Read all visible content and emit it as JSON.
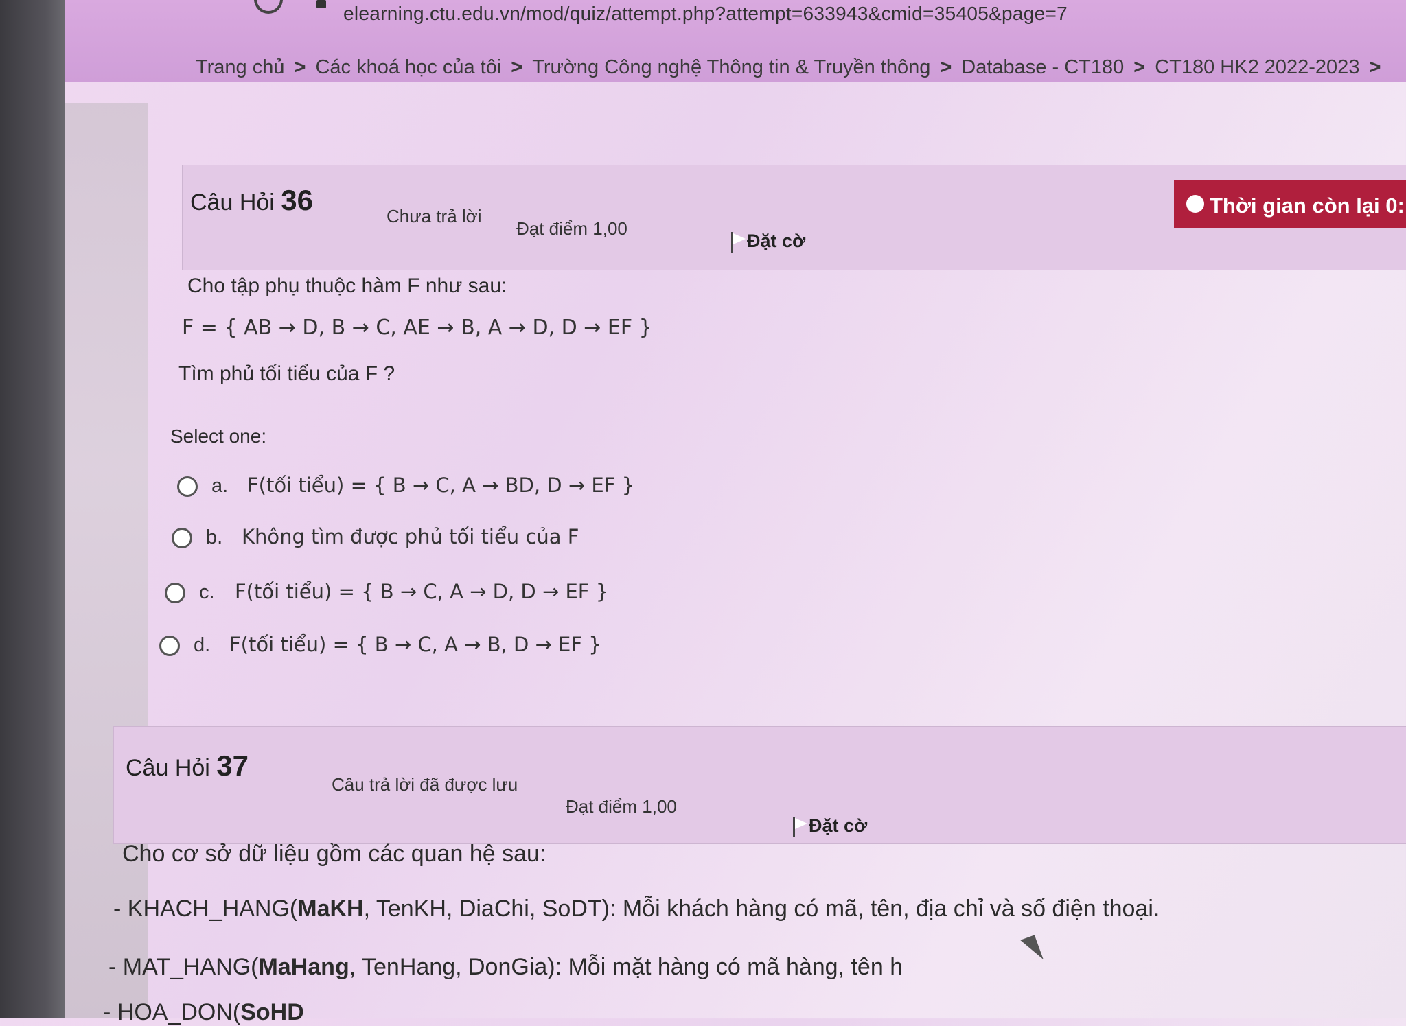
{
  "browser": {
    "url": "elearning.ctu.edu.vn/mod/quiz/attempt.php?attempt=633943&cmid=35405&page=7"
  },
  "breadcrumb": {
    "items": [
      "Trang chủ",
      "Các khoá học của tôi",
      "Trường Công nghệ Thông tin & Truyền thông",
      "Database - CT180",
      "CT180 HK2 2022-2023"
    ],
    "separator": ">"
  },
  "timer": {
    "label": "Thời gian còn lại 0:"
  },
  "q36": {
    "title_prefix": "Câu Hỏi",
    "number": "36",
    "state": "Chưa trả lời",
    "grade": "Đạt điểm 1,00",
    "flag_label": "Đặt cờ",
    "intro": "Cho tập phụ thuộc hàm F như sau:",
    "formula": "F = { AB → D, B → C, AE → B, A → D, D → EF }",
    "question": "Tìm phủ tối tiểu của F ?",
    "select_label": "Select one:",
    "options": [
      {
        "letter": "a.",
        "text": "F(tối tiểu) = { B → C, A → BD, D → EF }"
      },
      {
        "letter": "b.",
        "text": "Không tìm được phủ tối tiểu của F"
      },
      {
        "letter": "c.",
        "text": "F(tối tiểu) = { B → C, A → D, D → EF }"
      },
      {
        "letter": "d.",
        "text": "F(tối tiểu) = { B → C, A → B, D → EF }"
      }
    ]
  },
  "q37": {
    "title_prefix": "Câu Hỏi",
    "number": "37",
    "state": "Câu trả lời đã được lưu",
    "grade": "Đạt điểm 1,00",
    "flag_label": "Đặt cờ",
    "intro": "Cho cơ sở dữ liệu gồm các quan hệ sau:",
    "line1_pre": "- KHACH_HANG(",
    "line1_key": "MaKH",
    "line1_post": ", TenKH, DiaChi, SoDT): Mỗi khách hàng có mã, tên, địa chỉ và số điện thoại.",
    "line2_pre": "- MAT_HANG(",
    "line2_key": "MaHang",
    "line2_post": ", TenHang, DonGia): Mỗi mặt hàng có mã hàng, tên h",
    "line3_pre": "- HOA_DON(",
    "line3_key": "SoHD"
  }
}
